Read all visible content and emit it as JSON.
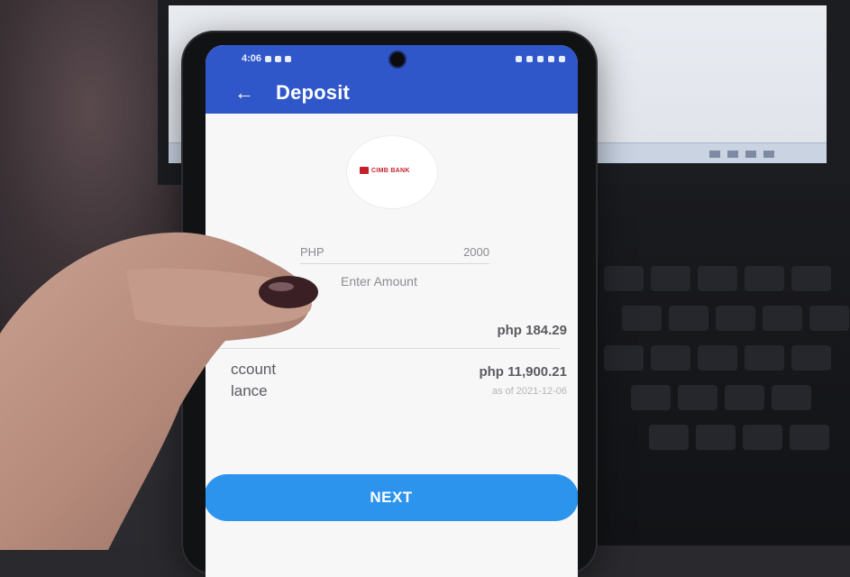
{
  "status_bar": {
    "time": "4:06",
    "colors": {
      "bar": "#2f57c9"
    }
  },
  "app_bar": {
    "title": "Deposit",
    "back_icon": "arrow-left-icon"
  },
  "bank": {
    "logo_text": "CIMB BANK",
    "brand_color": "#c8202a"
  },
  "amount": {
    "currency": "PHP",
    "value": "2000",
    "hint": "Enter Amount"
  },
  "fee": {
    "value": "php 184.29"
  },
  "balance": {
    "label": "ccount\nlance",
    "value": "php 11,900.21",
    "as_of": "as of 2021-12-06"
  },
  "actions": {
    "next_label": "NEXT",
    "accent_color": "#2d94ee"
  }
}
